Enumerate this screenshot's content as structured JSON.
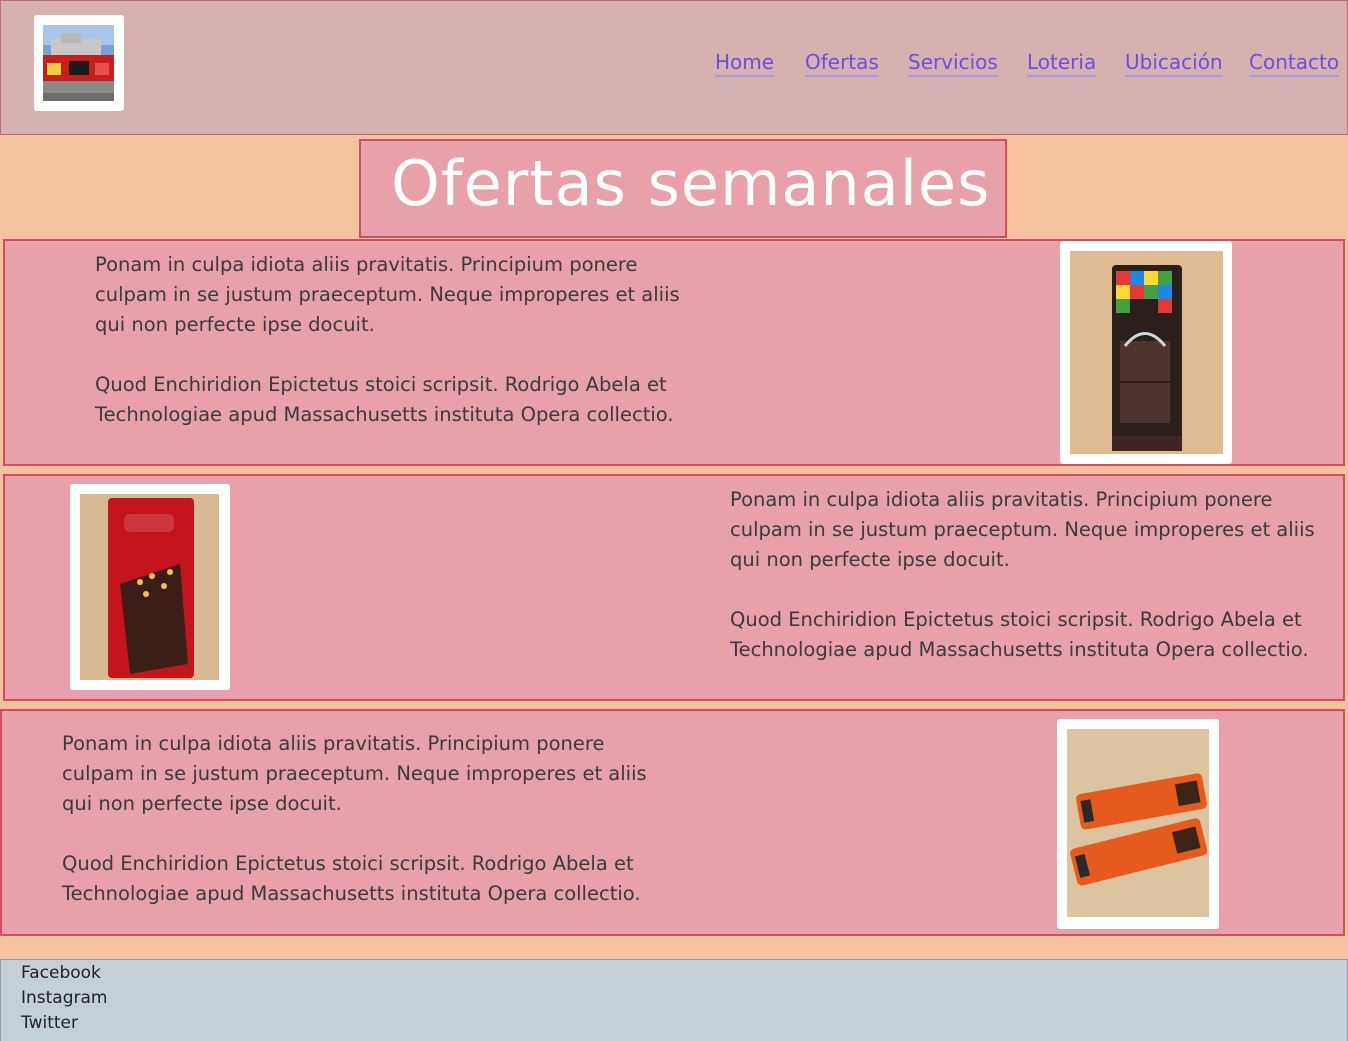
{
  "nav": {
    "items": [
      {
        "label": "Home"
      },
      {
        "label": "Ofertas"
      },
      {
        "label": "Servicios"
      },
      {
        "label": "Loteria"
      },
      {
        "label": "Ubicación"
      },
      {
        "label": "Contacto"
      }
    ]
  },
  "page_title": "Ofertas semanales",
  "offers": [
    {
      "para1": "Ponam in culpa idiota aliis pravitatis. Principium ponere culpam in se justum praeceptum. Neque improperes et aliis qui non perfecte ipse docuit.",
      "para2": "Quod Enchiridion Epictetus stoici scripsit. Rodrigo Abela et Technologiae apud Massachusetts instituta Opera collectio.",
      "image": "chocolate-pinata-bar-photo"
    },
    {
      "para1": "Ponam in culpa idiota aliis pravitatis. Principium ponere culpam in se justum praeceptum. Neque improperes et aliis qui non perfecte ipse docuit.",
      "para2": "Quod Enchiridion Epictetus stoici scripsit. Rodrigo Abela et Technologiae apud Massachusetts instituta Opera collectio.",
      "image": "nestle-mani-bar-photo"
    },
    {
      "para1": "Ponam in culpa idiota aliis pravitatis. Principium ponere culpam in se justum praeceptum. Neque improperes et aliis qui non perfecte ipse docuit.",
      "para2": "Quod Enchiridion Epictetus stoici scripsit. Rodrigo Abela et Technologiae apud Massachusetts instituta Opera collectio.",
      "image": "smack-bars-photo"
    }
  ],
  "footer": {
    "links": [
      {
        "label": "Facebook"
      },
      {
        "label": "Instagram"
      },
      {
        "label": "Twitter"
      }
    ]
  },
  "colors": {
    "background": "#f4c39d",
    "header": "#d5b2b0",
    "panel": "#e8a0aa",
    "panel_border": "#d24e5e",
    "nav_link": "#6a4fe0",
    "footer": "#c3cfd9"
  }
}
